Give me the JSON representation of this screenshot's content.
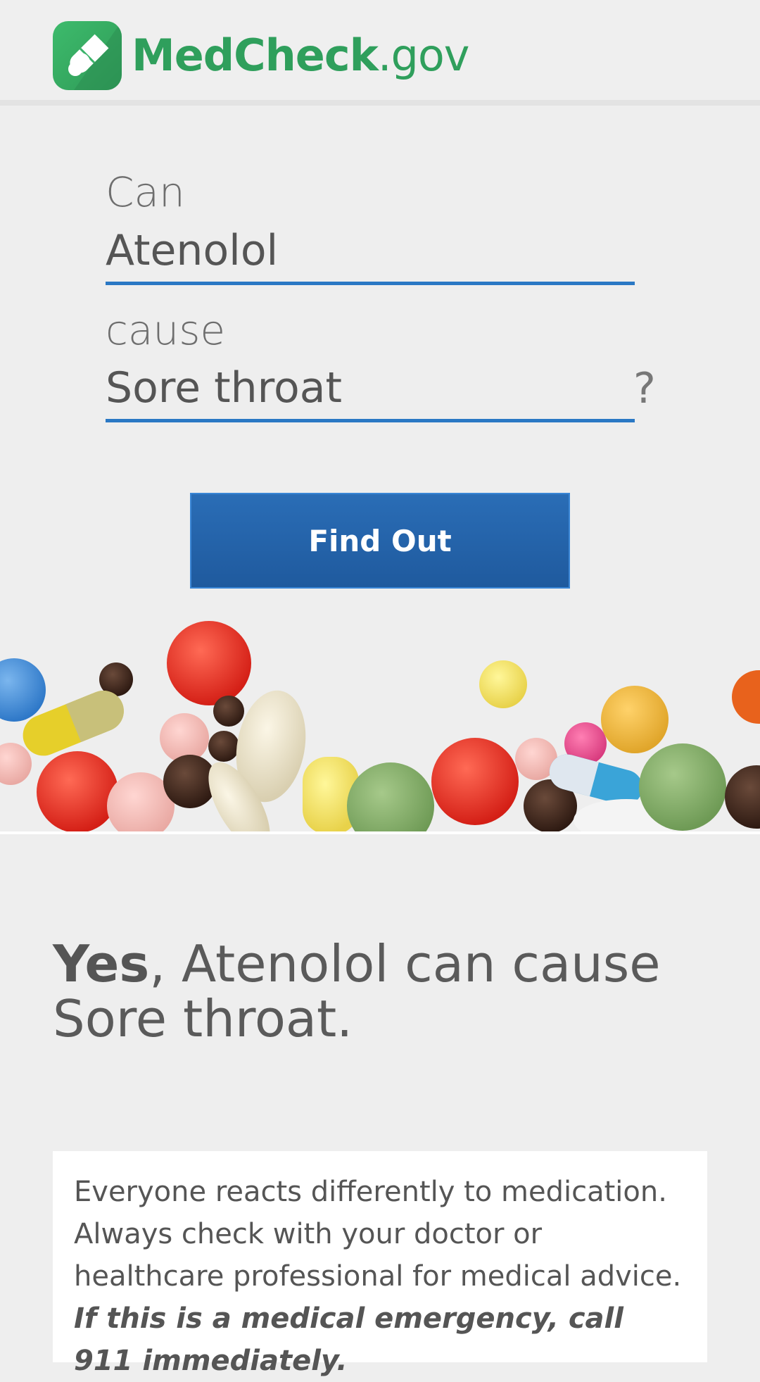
{
  "header": {
    "logo_text_main": "MedCheck",
    "logo_text_suffix": ".gov"
  },
  "form": {
    "label_can": "Can",
    "drug_value": "Atenolol",
    "label_cause": "cause",
    "symptom_value": "Sore throat",
    "question_mark": "?"
  },
  "button": {
    "find_out_label": "Find Out"
  },
  "answer": {
    "verdict": "Yes",
    "text": ", Atenolol can cause Sore throat."
  },
  "disclaimer": {
    "text": "Everyone reacts differently to medication. Always check with your doctor or healthcare professional for medical advice. ",
    "emphasis": "If this is a medical emergency, call 911 immediately."
  },
  "colors": {
    "brand_green": "#2f9f5c",
    "accent_blue": "#2a78c4",
    "button_blue": "#2462a8",
    "background": "#eeeeee"
  }
}
